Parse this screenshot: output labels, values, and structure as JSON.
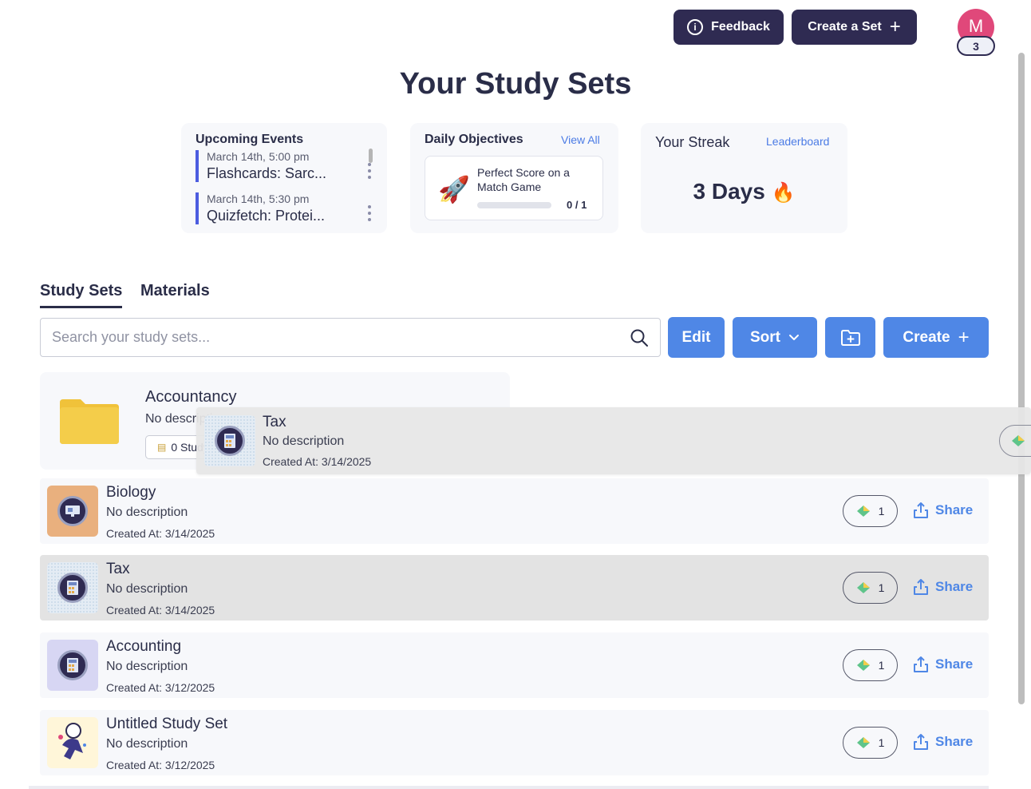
{
  "topbar": {
    "feedback_label": "Feedback",
    "info_glyph": "i",
    "create_set_label": "Create a Set",
    "plus_glyph": "+",
    "avatar_initial": "M",
    "avatar_badge": "3"
  },
  "page_title": "Your Study Sets",
  "events_card": {
    "title": "Upcoming Events",
    "events": [
      {
        "time": "March 14th, 5:00 pm",
        "name": "Flashcards: Sarc..."
      },
      {
        "time": "March 14th, 5:30 pm",
        "name": "Quizfetch: Protei..."
      }
    ]
  },
  "objectives_card": {
    "title": "Daily Objectives",
    "link": "View All",
    "objective": {
      "text": "Perfect Score on a Match Game",
      "progress_label": "0 / 1",
      "progress": 0
    },
    "rocket_glyph": "🚀"
  },
  "streak_card": {
    "title": "Your Streak",
    "link": "Leaderboard",
    "value": "3 Days",
    "fire_glyph": "🔥"
  },
  "tabs": [
    {
      "label": "Study Sets",
      "active": true
    },
    {
      "label": "Materials",
      "active": false
    }
  ],
  "search": {
    "placeholder": "Search your study sets..."
  },
  "actions": {
    "edit": "Edit",
    "sort": "Sort",
    "create": "Create",
    "chevron": "⌄"
  },
  "folder": {
    "name": "Accountancy",
    "description": "No description",
    "count_label": "0 Study Sets"
  },
  "drag_ghost": {
    "name": "Tax",
    "description": "No description",
    "date": "Created At: 3/14/2025"
  },
  "sets": [
    {
      "name": "Biology",
      "description": "No description",
      "date": "Created At: 3/14/2025",
      "count": "1",
      "share": "Share"
    },
    {
      "name": "Tax",
      "description": "No description",
      "date": "Created At: 3/14/2025",
      "count": "1",
      "share": "Share"
    },
    {
      "name": "Accounting",
      "description": "No description",
      "date": "Created At: 3/12/2025",
      "count": "1",
      "share": "Share"
    },
    {
      "name": "Untitled Study Set",
      "description": "No description",
      "date": "Created At: 3/12/2025",
      "count": "1",
      "share": "Share"
    }
  ],
  "colors": {
    "navy": "#2f2b52",
    "primary_blue": "#4f87e6",
    "link_blue": "#4b7be5",
    "avatar_pink": "#e0487a",
    "folder_yellow": "#f4cd4a",
    "selected_row": "#e3e3e3"
  }
}
